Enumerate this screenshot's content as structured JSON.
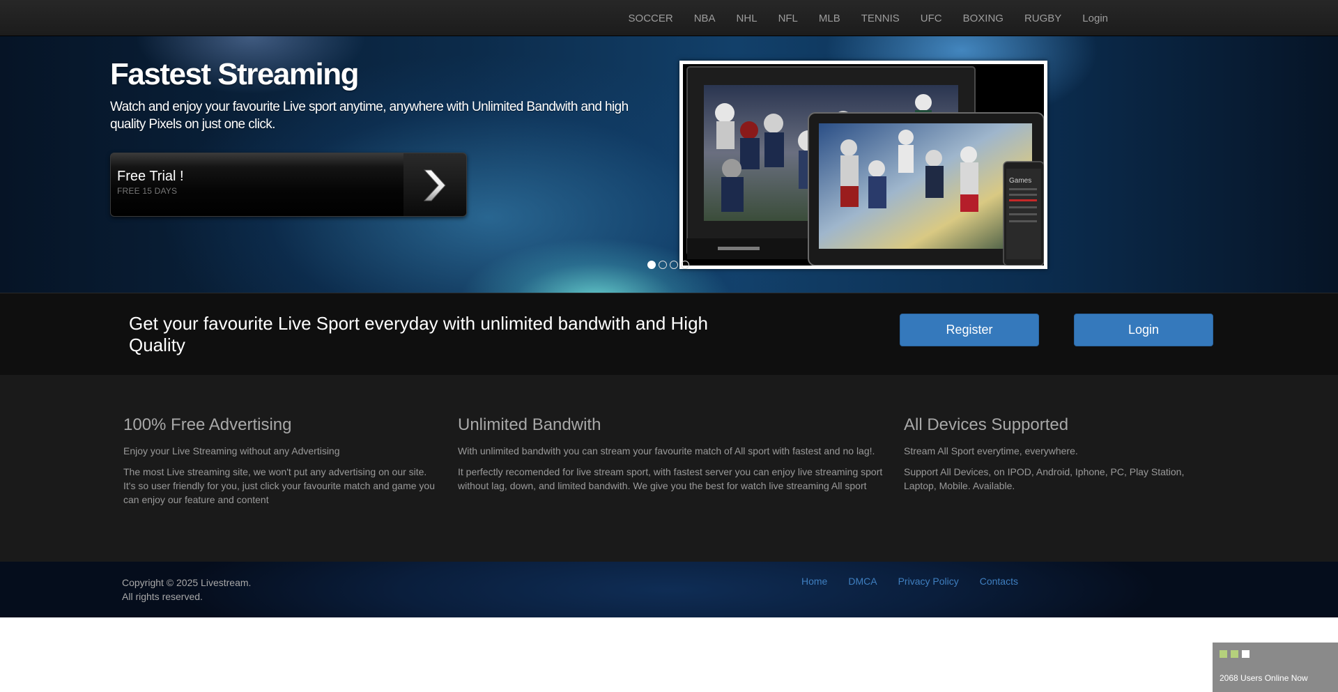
{
  "nav": {
    "items": [
      "SOCCER",
      "NBA",
      "NHL",
      "NFL",
      "MLB",
      "TENNIS",
      "UFC",
      "BOXING",
      "RUGBY",
      "Login"
    ]
  },
  "hero": {
    "title": "Fastest Streaming",
    "subtitle": "Watch and enjoy your favourite Live sport anytime, anywhere with Unlimited Bandwith and high quality Pixels on just one click.",
    "trial": {
      "title": "Free Trial !",
      "subtitle": "FREE 15 DAYS"
    },
    "slider": {
      "slide_count": 4,
      "active_index": 0
    },
    "screen_text": "Games"
  },
  "cta": {
    "text": "Get your favourite Live Sport everyday with unlimited bandwith and High Quality",
    "register_label": "Register",
    "login_label": "Login"
  },
  "features": [
    {
      "title": "100% Free Advertising",
      "p1": "Enjoy your Live Streaming without any Advertising",
      "p2": "The most Live streaming site, we won't put any advertising on our site. It's so user friendly for you, just click your favourite match and game you can enjoy our feature and content"
    },
    {
      "title": "Unlimited Bandwith",
      "p1": "With unlimited bandwith you can stream your favourite match of All sport with fastest and no lag!.",
      "p2": "It perfectly recomended for live stream sport, with fastest server you can enjoy live streaming sport without lag, down, and limited bandwith. We give you the best for watch live streaming All sport"
    },
    {
      "title": "All Devices Supported",
      "p1": "Stream All Sport everytime, everywhere.",
      "p2": "Support All Devices, on IPOD, Android, Iphone, PC, Play Station, Laptop, Mobile. Available."
    }
  ],
  "footer": {
    "copyright_line1": "Copyright © 2025 Livestream.",
    "copyright_line2": "All rights reserved.",
    "links": [
      "Home",
      "DMCA",
      "Privacy Policy",
      "Contacts"
    ]
  },
  "online_widget": {
    "text": "2068 Users Online Now",
    "square_colors": [
      "#b5d17c",
      "#b5d17c",
      "#ffffff"
    ]
  },
  "colors": {
    "accent_blue": "#3579bc",
    "link_blue": "#3f7fc0",
    "nav_text": "#9d9d9d"
  }
}
